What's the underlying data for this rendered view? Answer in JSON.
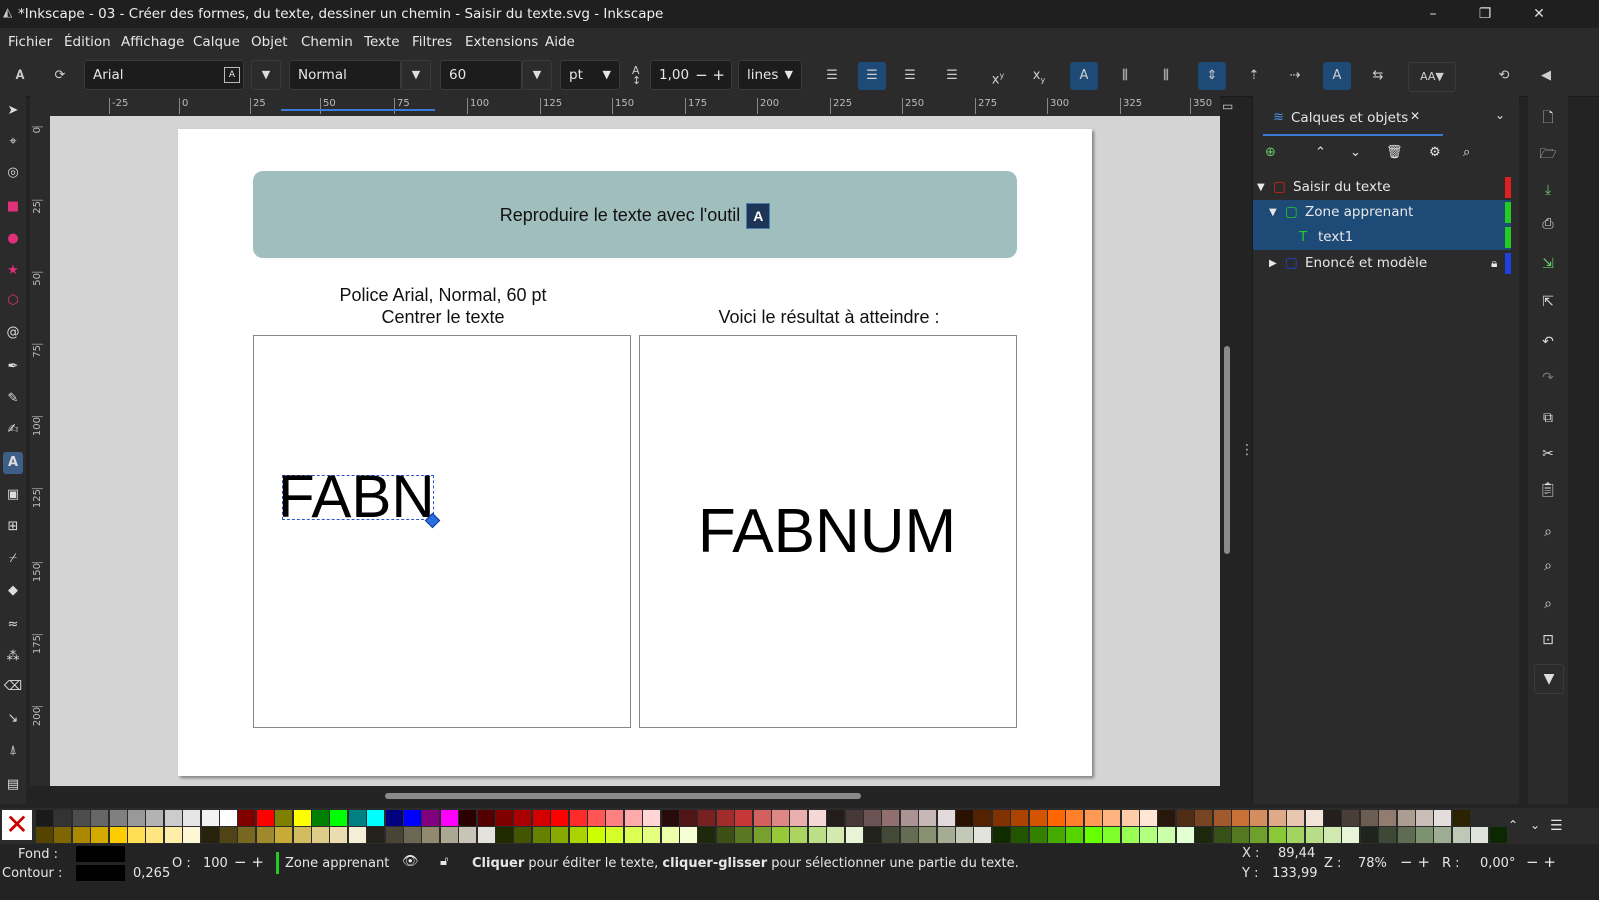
{
  "window": {
    "title": "*Inkscape - 03 - Créer des formes, du texte, dessiner un chemin - Saisir du texte.svg - Inkscape"
  },
  "menu": [
    "Fichier",
    "Édition",
    "Affichage",
    "Calque",
    "Objet",
    "Chemin",
    "Texte",
    "Filtres",
    "Extensions",
    "Aide"
  ],
  "toolctrl": {
    "font_family": "Arial",
    "font_style": "Normal",
    "font_size": "60",
    "unit": "pt",
    "line_spacing": "1,00",
    "spacing_mode": "lines"
  },
  "ruler_h": [
    "-25",
    "0",
    "25",
    "50",
    "75",
    "100",
    "125",
    "150",
    "175",
    "200",
    "225",
    "250",
    "275",
    "300",
    "325",
    "350"
  ],
  "ruler_v": [
    "0",
    "25",
    "50",
    "75",
    "100",
    "125",
    "150",
    "175",
    "200"
  ],
  "document": {
    "banner": "Reproduire le texte avec l'outil",
    "banner_icon": "A",
    "left_caption_1": "Police Arial, Normal, 60 pt",
    "left_caption_2": "Centrer le texte",
    "right_caption": "Voici le résultat à atteindre :",
    "edit_text": "FABN",
    "target_text": "FABNUM"
  },
  "dock": {
    "tab": "Calques et objets",
    "layers": [
      {
        "label": "Saisir du texte",
        "color": "#e02020"
      },
      {
        "label": "Zone apprenant",
        "color": "#22cc22"
      },
      {
        "label": "text1",
        "color": "#22cc22"
      },
      {
        "label": "Enoncé et modèle",
        "color": "#2040e0"
      }
    ]
  },
  "status": {
    "fill_label": "Fond :",
    "stroke_label": "Contour :",
    "stroke_width": "0,265",
    "opacity_label": "O :",
    "opacity": "100",
    "layer": "Zone apprenant",
    "msg_click": "Cliquer",
    "msg_1": " pour éditer le texte, ",
    "msg_drag": "cliquer-glisser",
    "msg_2": " pour sélectionner une partie du texte.",
    "x_label": "X :",
    "x": "89,44",
    "y_label": "Y :",
    "y": "133,99",
    "z_label": "Z :",
    "zoom": "78%",
    "r_label": "R :",
    "rotation": "0,00°"
  }
}
